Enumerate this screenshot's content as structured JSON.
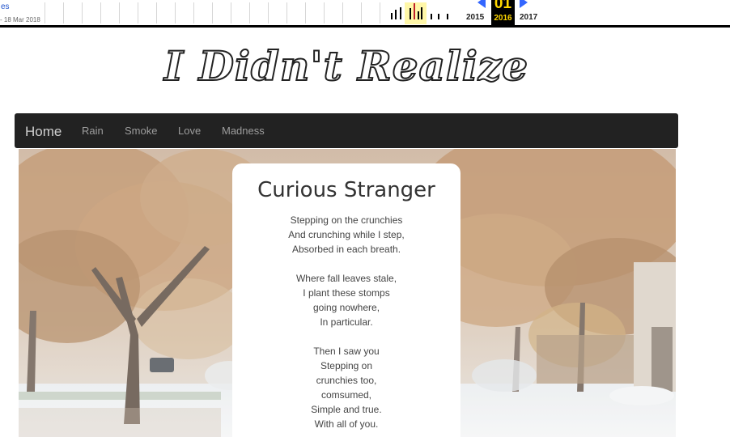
{
  "wayback": {
    "link_text": "es",
    "date_range": "- 18 Mar 2018",
    "prev_year": "2015",
    "current_month": "01",
    "current_year": "2016",
    "next_year": "2017",
    "accent_color": "#3366ff",
    "highlight_color": "#ffd700"
  },
  "site": {
    "title": "I Didn't Realize"
  },
  "nav": {
    "brand": "Home",
    "items": [
      {
        "label": "Rain"
      },
      {
        "label": "Smoke"
      },
      {
        "label": "Love"
      },
      {
        "label": "Madness"
      }
    ]
  },
  "poem": {
    "title": "Curious Stranger",
    "stanzas": [
      [
        "Stepping on the crunchies",
        "And crunching while I step,",
        "Absorbed in each breath."
      ],
      [
        "Where fall leaves stale,",
        "I plant these stomps",
        "going nowhere,",
        "In particular."
      ],
      [
        "Then I saw you",
        "Stepping on",
        "crunchies too,",
        "comsumed,",
        "Simple and true.",
        "With all of you."
      ]
    ]
  },
  "hero": {
    "icon": "autumn-trees-snow-photo"
  }
}
